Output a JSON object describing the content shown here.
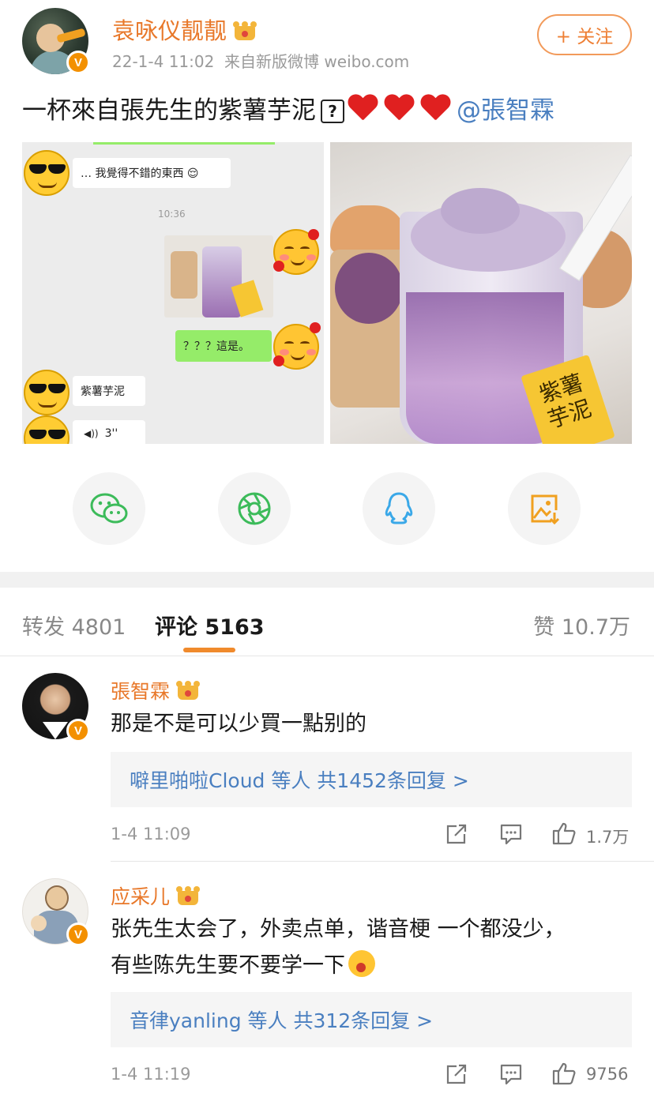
{
  "post": {
    "author": "袁咏仪靓靓",
    "time": "22-1-4 11:02",
    "source": "来自新版微博 weibo.com",
    "follow_label": "+ 关注",
    "text_main": "一杯來自張先生的紫薯芋泥",
    "question_mark": "?",
    "mention": "@張智霖"
  },
  "chat_image": {
    "msg1": "… 我覺得不錯的東西 😌",
    "time": "10:36",
    "msg2": "？？？這是。",
    "msg3": "紫薯芋泥",
    "voice": "3''"
  },
  "photo_image": {
    "tag_text": "紫薯芋泥"
  },
  "share_buttons": [
    {
      "icon": "wechat-icon"
    },
    {
      "icon": "moments-icon"
    },
    {
      "icon": "qq-icon"
    },
    {
      "icon": "save-image-icon"
    }
  ],
  "tabs": {
    "repost": "转发 4801",
    "comments": "评论 5163",
    "likes": "赞 10.7万"
  },
  "comments": [
    {
      "name": "張智霖",
      "text": "那是不是可以少買一點别的",
      "replies": "噼里啪啦Cloud 等人  共1452条回复 >",
      "time": "1-4 11:09",
      "likes": "1.7万"
    },
    {
      "name": "应采儿",
      "text_line1": "张先生太会了，外卖点单，谐音梗 一个都没少，",
      "text_line2": "有些陈先生要不要学一下",
      "replies": "音律yanling 等人  共312条回复 >",
      "time": "1-4 11:19",
      "likes": "9756"
    }
  ],
  "colors": {
    "accent_orange": "#e8782a",
    "link_blue": "#4a7fc0",
    "verified_badge": "#f39000"
  }
}
